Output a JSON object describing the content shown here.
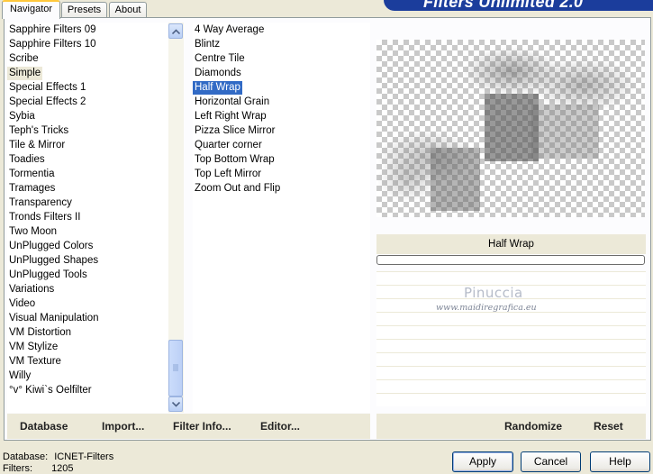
{
  "banner": {
    "title": "Filters Unlimited 2.0"
  },
  "tabs": [
    {
      "label": "Navigator",
      "active": true
    },
    {
      "label": "Presets",
      "active": false
    },
    {
      "label": "About",
      "active": false
    }
  ],
  "categories": [
    "Sapphire Filters 09",
    "Sapphire Filters 10",
    "Scribe",
    "Simple",
    "Special Effects 1",
    "Special Effects 2",
    "Sybia",
    "Teph's Tricks",
    "Tile & Mirror",
    "Toadies",
    "Tormentia",
    "Tramages",
    "Transparency",
    "Tronds Filters II",
    "Two Moon",
    "UnPlugged Colors",
    "UnPlugged Shapes",
    "UnPlugged Tools",
    "Variations",
    "Video",
    "Visual Manipulation",
    "VM Distortion",
    "VM Stylize",
    "VM Texture",
    "Willy",
    "°v° Kiwi`s Oelfilter"
  ],
  "selected_category": "Simple",
  "filters": [
    "4 Way Average",
    "Blintz",
    "Centre Tile",
    "Diamonds",
    "Half Wrap",
    "Horizontal Grain",
    "Left Right Wrap",
    "Pizza Slice Mirror",
    "Quarter corner",
    "Top Bottom Wrap",
    "Top Left Mirror",
    "Zoom Out and Flip"
  ],
  "selected_filter": "Half Wrap",
  "links": {
    "database": "Database",
    "import": "Import...",
    "filter_info": "Filter Info...",
    "editor": "Editor...",
    "randomize": "Randomize",
    "reset": "Reset"
  },
  "preview": {
    "filter_name": "Half Wrap"
  },
  "watermark": {
    "name": "Pinuccia",
    "url": "www.maidiregrafica.eu"
  },
  "status": {
    "database_label": "Database:",
    "database_value": "ICNET-Filters",
    "filters_label": "Filters:",
    "filters_value": "1205"
  },
  "buttons": {
    "apply": "Apply",
    "cancel": "Cancel",
    "help": "Help"
  },
  "colors": {
    "selection": "#316ac5",
    "banner": "#1b3d9c"
  }
}
